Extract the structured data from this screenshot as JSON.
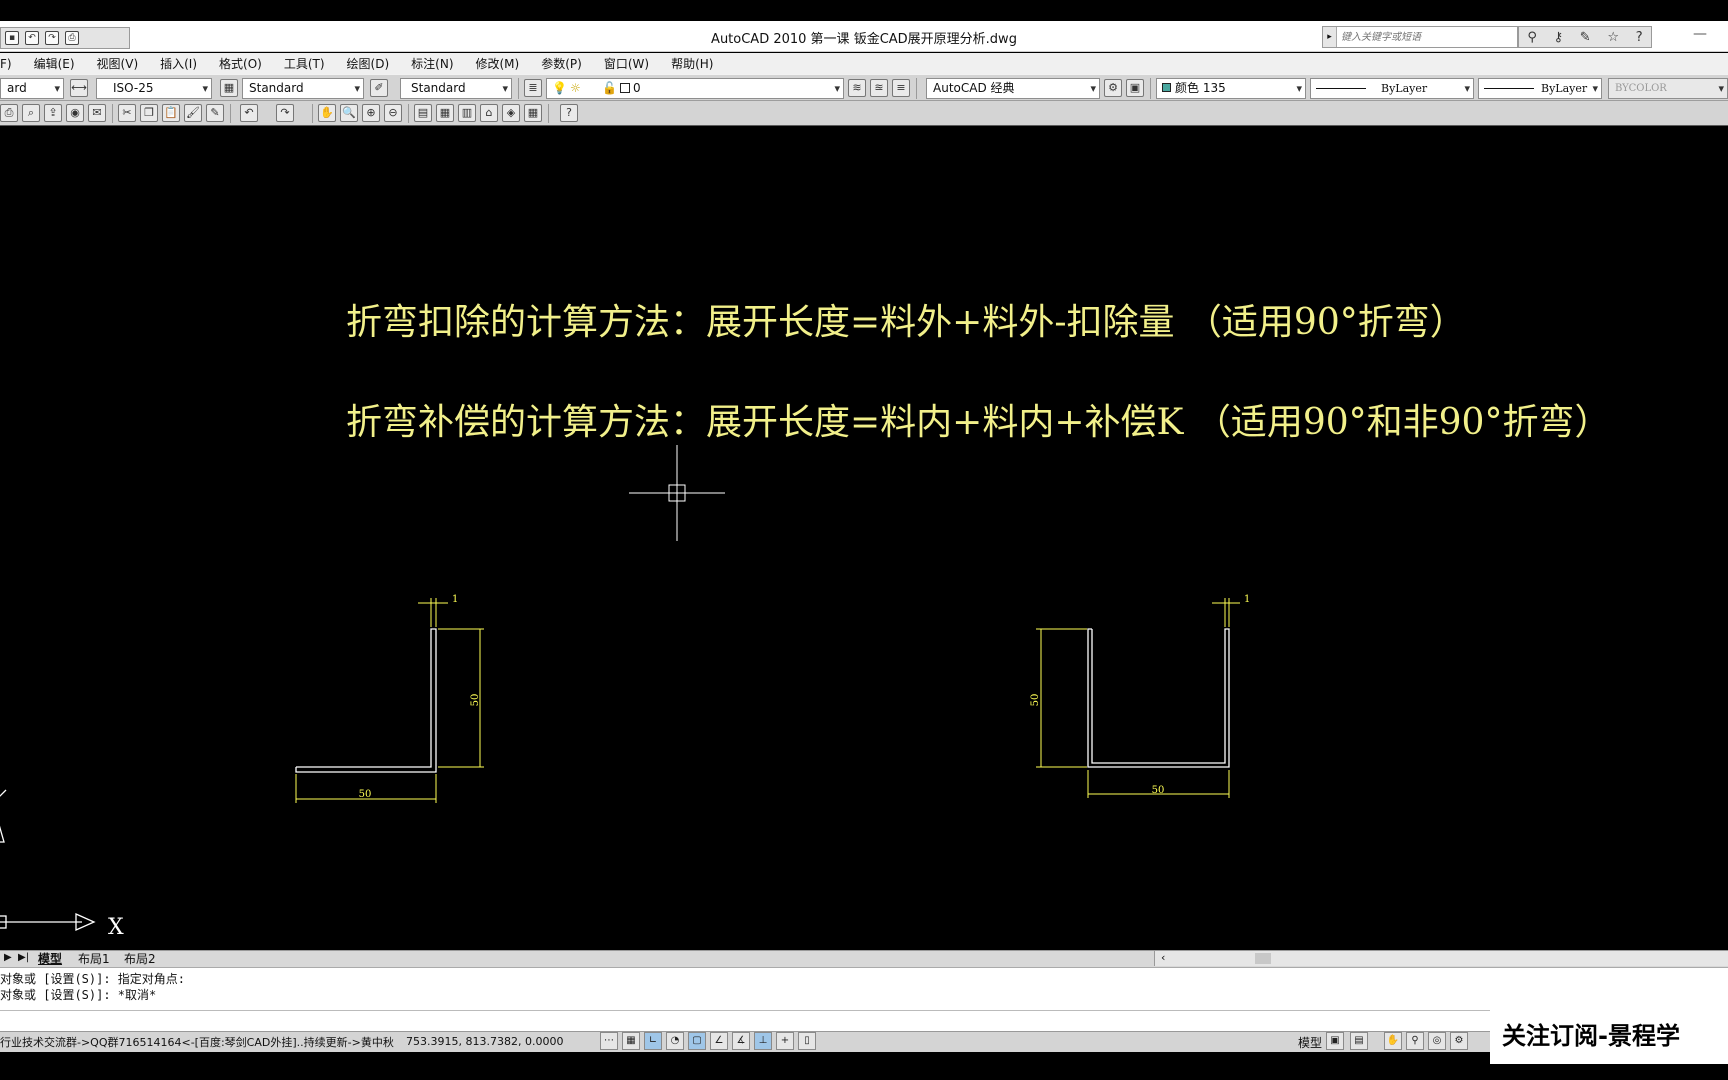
{
  "window": {
    "title": "AutoCAD 2010      第一课 钣金CAD展开原理分析.dwg",
    "search_placeholder": "键入关键字或短语",
    "minimize": "—"
  },
  "menubar": [
    "F)",
    "编辑(E)",
    "视图(V)",
    "插入(I)",
    "格式(O)",
    "工具(T)",
    "绘图(D)",
    "标注(N)",
    "修改(M)",
    "参数(P)",
    "窗口(W)",
    "帮助(H)"
  ],
  "toolbar": {
    "text_style": "ard",
    "dim_style": "ISO-25",
    "table_style": "Standard",
    "multileader_style": "Standard",
    "layer": "0",
    "workspace": "AutoCAD 经典",
    "color": "颜色 135",
    "linetype": "ByLayer",
    "lineweight": "ByLayer",
    "plotstyle": "BYCOLOR"
  },
  "drawing": {
    "line1": "折弯扣除的计算方法：展开长度=料外+料外-扣除量  （适用90°折弯）",
    "line2": "折弯补偿的计算方法：展开长度=料内+料内+补偿K   （适用90°和非90°折弯）",
    "left_part": {
      "thickness": "1",
      "height": "50",
      "width": "50"
    },
    "right_part": {
      "thickness": "1",
      "height": "50",
      "width": "50"
    },
    "ucs_x": "X",
    "text_color": "#f2f08a",
    "line_color": "#ffffff",
    "dim_color": "#ffff55"
  },
  "tabs": [
    "模型",
    "布局1",
    "布局2"
  ],
  "command": {
    "line1": "对象或 [设置(S)]: 指定对角点:",
    "line2": "对象或 [设置(S)]: *取消*"
  },
  "status": {
    "text": "行业技术交流群->QQ群716514164<-[百度:琴剑CAD外挂]..持续更新->黄中秋",
    "coords": "753.3915, 813.7382, 0.0000",
    "model_label": "模型"
  },
  "watermark": "关注订阅-景程学"
}
